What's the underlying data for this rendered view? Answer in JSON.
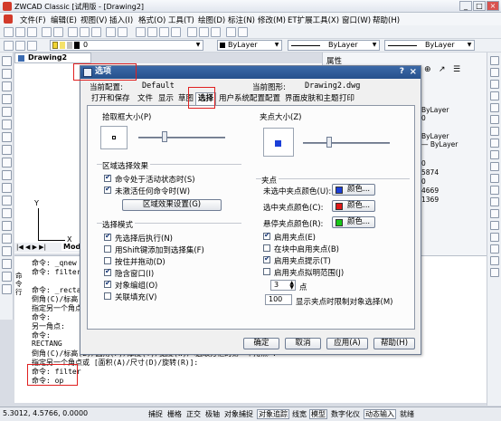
{
  "app": {
    "title": "ZWCAD Classic [试用版 - [Drawing2]",
    "window_buttons": [
      "_",
      "□",
      "×"
    ]
  },
  "menu": [
    "文件(F)",
    "编辑(E)",
    "视图(V)",
    "插入(I)",
    "格式(O)",
    "工具(T)",
    "绘图(D)",
    "标注(N)",
    "修改(M)",
    "ET扩展工具(X)",
    "窗口(W)",
    "帮助(H)"
  ],
  "toolbar": {
    "layer_value": "0",
    "color_value": "ByLayer",
    "linetype_value": "ByLayer",
    "lineweight_value": "ByLayer"
  },
  "drawing": {
    "tab_label": "Drawing2",
    "axis_x": "X",
    "axis_y": "Y",
    "model_tab": "Model"
  },
  "properties": {
    "title": "属性",
    "values": [
      "ByLayer",
      "0",
      "ByLayer",
      "— ByLayer",
      "",
      "",
      "",
      "0",
      "5874",
      "0",
      "4669",
      "1369"
    ]
  },
  "command_lines": [
    "命令: _qnew",
    "命令: filter",
    "",
    "命令: _rectang",
    "倒角(C)/标高(E)/圆角(F)/厚度(T)/宽度(W)/<选取方框的第一个角点>:",
    "指定另一个角点或 [面积(A)/尺寸(D)/旋转(R)]:",
    "命令:",
    "另一角点:",
    "命令:",
    "RECTANG",
    "倒角(C)/标高(E)/圆角(F)/厚度(T)/宽度(W)/<选取方框的第一个角点>:",
    "指定另一个角点或 [面积(A)/尺寸(D)/旋转(R)]:",
    "命令: filter",
    "命令: op"
  ],
  "command_label": "命令行",
  "status": {
    "coords": "5.3012, 4.5766, 0.0000",
    "toggles": [
      {
        "label": "捕捉",
        "on": false
      },
      {
        "label": "栅格",
        "on": false
      },
      {
        "label": "正交",
        "on": false
      },
      {
        "label": "极轴",
        "on": false
      },
      {
        "label": "对象捕捉",
        "on": false
      },
      {
        "label": "对象追踪",
        "on": true
      },
      {
        "label": "线宽",
        "on": false
      },
      {
        "label": "模型",
        "on": true
      },
      {
        "label": "数字化仪",
        "on": false
      },
      {
        "label": "动态输入",
        "on": true
      },
      {
        "label": "就绪",
        "on": false
      }
    ]
  },
  "dialog": {
    "title": "选项",
    "help_glyph": "?",
    "close_glyph": "×",
    "current_profile_label": "当前配置:",
    "current_profile_value": "Default",
    "current_drawing_label": "当前图形:",
    "current_drawing_value": "Drawing2.dwg",
    "tabs": [
      "打开和保存",
      "文件",
      "显示",
      "草图",
      "选择",
      "用户系统配置",
      "配置",
      "界面皮肤和主题",
      "打印"
    ],
    "active_tab": "选择",
    "pickbox_title": "拾取框大小(P)",
    "pickbox_level": 0.3,
    "grip_size_title": "夹点大小(Z)",
    "grip_size_level": 0.3,
    "selection_effects_title": "区域选择效果",
    "selection_effects": [
      {
        "label": "命令处于活动状态时(S)",
        "checked": true
      },
      {
        "label": "未激活任何命令时(W)",
        "checked": true
      }
    ],
    "effect_settings_button": "区域效果设置(G)",
    "selection_mode_title": "选择模式",
    "selection_modes": [
      {
        "label": "先选择后执行(N)",
        "checked": true
      },
      {
        "label": "用Shift键添加到选择集(F)",
        "checked": false
      },
      {
        "label": "按住并拖动(D)",
        "checked": false
      },
      {
        "label": "隐含窗口(I)",
        "checked": true
      },
      {
        "label": "对象编组(O)",
        "checked": true
      },
      {
        "label": "关联填充(V)",
        "checked": false
      }
    ],
    "grips_title": "夹点",
    "grip_colors": [
      {
        "label": "未选中夹点颜色(U):",
        "color": "#1b3fd8",
        "button": "颜色..."
      },
      {
        "label": "选中夹点颜色(C):",
        "color": "#e01818",
        "button": "颜色..."
      },
      {
        "label": "悬停夹点颜色(R):",
        "color": "#18c818",
        "button": "颜色..."
      }
    ],
    "grip_options": [
      {
        "label": "启用夹点(E)",
        "checked": true
      },
      {
        "label": "在块中启用夹点(B)",
        "checked": false
      },
      {
        "label": "启用夹点提示(T)",
        "checked": true
      },
      {
        "label": "启用夹点拟明范围(J)",
        "checked": false
      }
    ],
    "spin_value": "3",
    "spin_unit": "点",
    "limit_value": "100",
    "limit_label": "显示夹点时限制对象选择(M)",
    "buttons": {
      "ok": "确定",
      "cancel": "取消",
      "apply": "应用(A)",
      "help": "帮助(H)"
    }
  },
  "colors": {
    "dialog_title_bg": "#27518c",
    "highlight_box": "#e02020"
  }
}
